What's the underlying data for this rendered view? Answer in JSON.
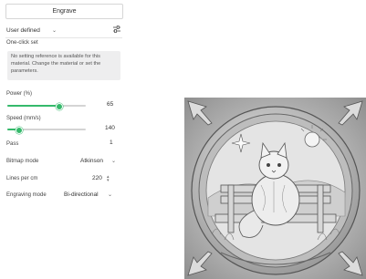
{
  "panel": {
    "engrave_label": "Engrave",
    "preset": {
      "value": "User defined"
    },
    "one_click_set": {
      "title": "One-click set",
      "message": "No setting reference is available for this material. Change the material or set the parameters."
    },
    "power": {
      "label": "Power (%)",
      "value": "65",
      "level": 0.65
    },
    "speed": {
      "label": "Speed (mm/s)",
      "value": "140",
      "level": 0.14
    },
    "pass": {
      "label": "Pass",
      "value": "1"
    },
    "bitmap_mode": {
      "label": "Bitmap mode",
      "value": "Atkinson"
    },
    "lines_per_cm": {
      "label": "Lines per cm",
      "value": "220"
    },
    "engraving_mode": {
      "label": "Engraving mode",
      "value": "Bi-directional"
    }
  },
  "colors": {
    "accent": "#35b96b",
    "info_bg": "#eeeeef"
  },
  "icons": {
    "settings": "sliders-icon",
    "preview": "engraving-preview-image"
  }
}
